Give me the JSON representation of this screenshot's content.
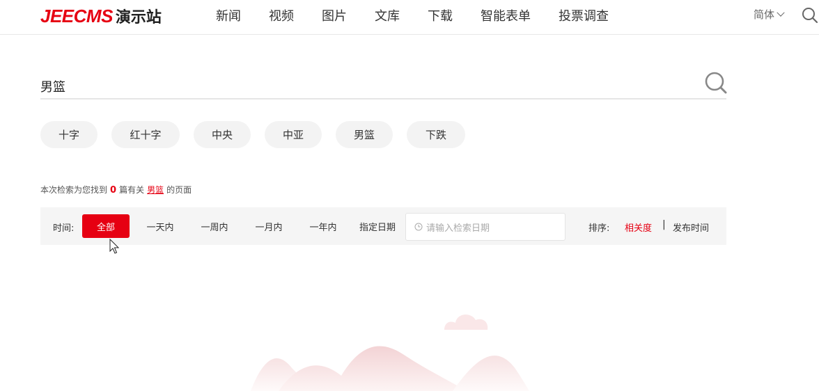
{
  "header": {
    "logo_brand": "JEECMS",
    "logo_sub": "演示站",
    "nav": [
      "新闻",
      "视频",
      "图片",
      "文库",
      "下载",
      "智能表单",
      "投票调查"
    ],
    "lang": "简体"
  },
  "search": {
    "value": "男篮"
  },
  "tags": [
    "十字",
    "红十字",
    "中央",
    "中亚",
    "男篮",
    "下跌"
  ],
  "summary": {
    "prefix": "本次检索为您找到",
    "count": "0",
    "middle": "篇有关",
    "keyword": "男篮",
    "suffix": "的页面"
  },
  "filter": {
    "time_label": "时间:",
    "options": [
      "全部",
      "一天内",
      "一周内",
      "一月内",
      "一年内"
    ],
    "active_option": "全部",
    "custom_date_label": "指定日期",
    "date_placeholder": "请输入检索日期",
    "sort_label": "排序:",
    "sort_options": [
      "相关度",
      "发布时间"
    ],
    "sort_divider": "|",
    "active_sort": "相关度"
  },
  "colors": {
    "accent": "#e60012",
    "tag_bg": "#f3f3f3",
    "filter_bg": "#f5f5f5"
  }
}
